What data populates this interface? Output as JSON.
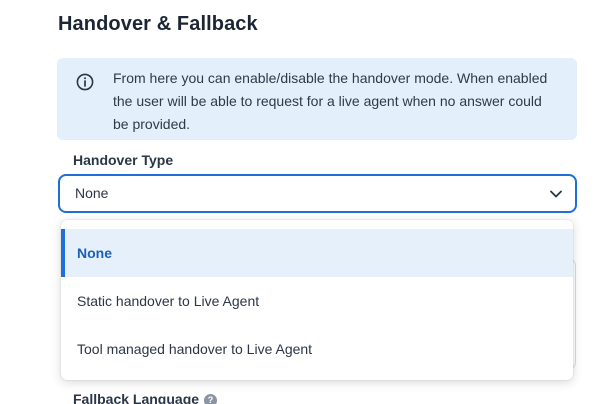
{
  "section": {
    "title": "Handover & Fallback"
  },
  "info": {
    "icon": "info-circle-icon",
    "text": "From here you can enable/disable the handover mode. When enabled the user will be able to request for a live agent when no answer could be provided."
  },
  "handover_type": {
    "label": "Handover Type",
    "selected_value": "None",
    "options": [
      {
        "label": "None",
        "selected": true
      },
      {
        "label": "Static handover to Live Agent",
        "selected": false
      },
      {
        "label": "Tool managed handover to Live Agent",
        "selected": false
      }
    ]
  },
  "fallback_language": {
    "label": "Fallback Language",
    "help_icon": "question-circle-icon",
    "help_glyph": "?"
  },
  "colors": {
    "accent": "#1e6fd9",
    "info_background": "#e3effb",
    "selected_option_background": "#e6f0fb"
  }
}
